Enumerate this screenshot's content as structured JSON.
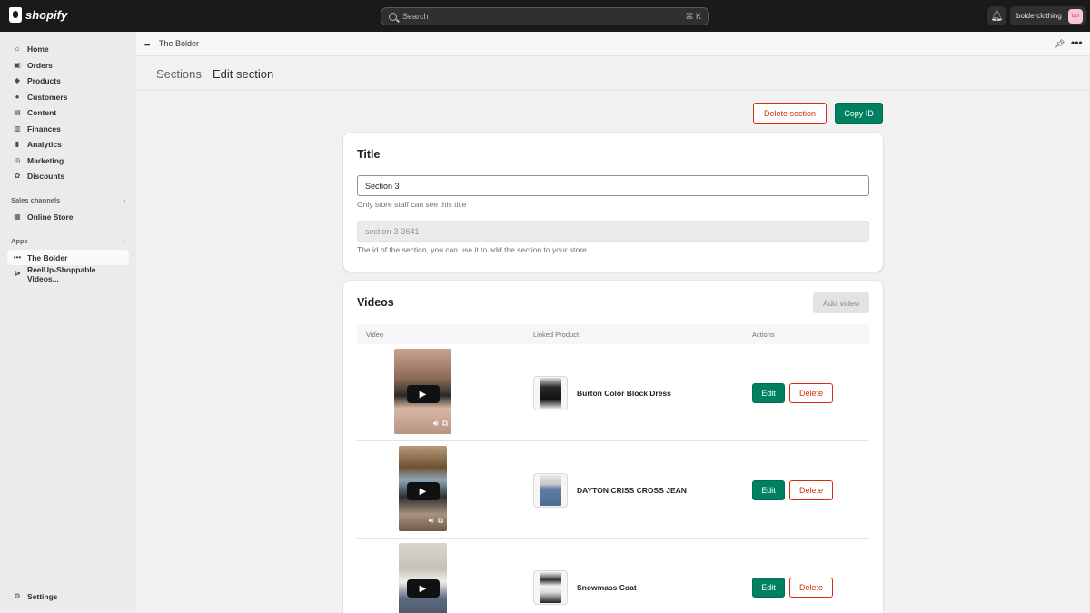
{
  "topbar": {
    "logo_text": "shopify",
    "search_placeholder": "Search",
    "search_shortcut": "⌘ K",
    "store_name": "bolderclothing",
    "avatar_text": "bol"
  },
  "sidebar": {
    "items": [
      {
        "label": "Home",
        "icon": "home-icon",
        "glyph": "⌂"
      },
      {
        "label": "Orders",
        "icon": "orders-icon",
        "glyph": "▣"
      },
      {
        "label": "Products",
        "icon": "tag-icon",
        "glyph": "◆"
      },
      {
        "label": "Customers",
        "icon": "person-icon",
        "glyph": "●"
      },
      {
        "label": "Content",
        "icon": "content-icon",
        "glyph": "▤"
      },
      {
        "label": "Finances",
        "icon": "bank-icon",
        "glyph": "▥"
      },
      {
        "label": "Analytics",
        "icon": "bar-chart-icon",
        "glyph": "▮"
      },
      {
        "label": "Marketing",
        "icon": "target-icon",
        "glyph": "◎"
      },
      {
        "label": "Discounts",
        "icon": "discount-icon",
        "glyph": "✿"
      }
    ],
    "sales_channels_label": "Sales channels",
    "online_store_label": "Online Store",
    "apps_label": "Apps",
    "app_items": [
      {
        "label": "The Bolder"
      },
      {
        "label": "ReelUp-Shoppable Videos..."
      }
    ],
    "settings_label": "Settings"
  },
  "app_header": {
    "app_name": "The Bolder"
  },
  "breadcrumb": {
    "parent": "Sections",
    "current": "Edit section"
  },
  "actions": {
    "delete_section": "Delete section",
    "copy_id": "Copy ID"
  },
  "title_card": {
    "heading": "Title",
    "title_value": "Section 3",
    "title_help": "Only store staff can see this title",
    "id_value": "section-3-3641",
    "id_help": "The id of the section, you can use it to add the section to your store"
  },
  "videos_card": {
    "heading": "Videos",
    "add_video": "Add video",
    "columns": [
      "Video",
      "Linked Product",
      "Actions"
    ],
    "rows": [
      {
        "product": "Burton Color Block Dress",
        "edit": "Edit",
        "delete": "Delete"
      },
      {
        "product": "DAYTON CRISS CROSS JEAN",
        "edit": "Edit",
        "delete": "Delete"
      },
      {
        "product": "Snowmass Coat",
        "edit": "Edit",
        "delete": "Delete"
      }
    ]
  },
  "colors": {
    "primary": "#008060",
    "danger": "#d72c0d",
    "topbar": "#1a1a1a"
  }
}
